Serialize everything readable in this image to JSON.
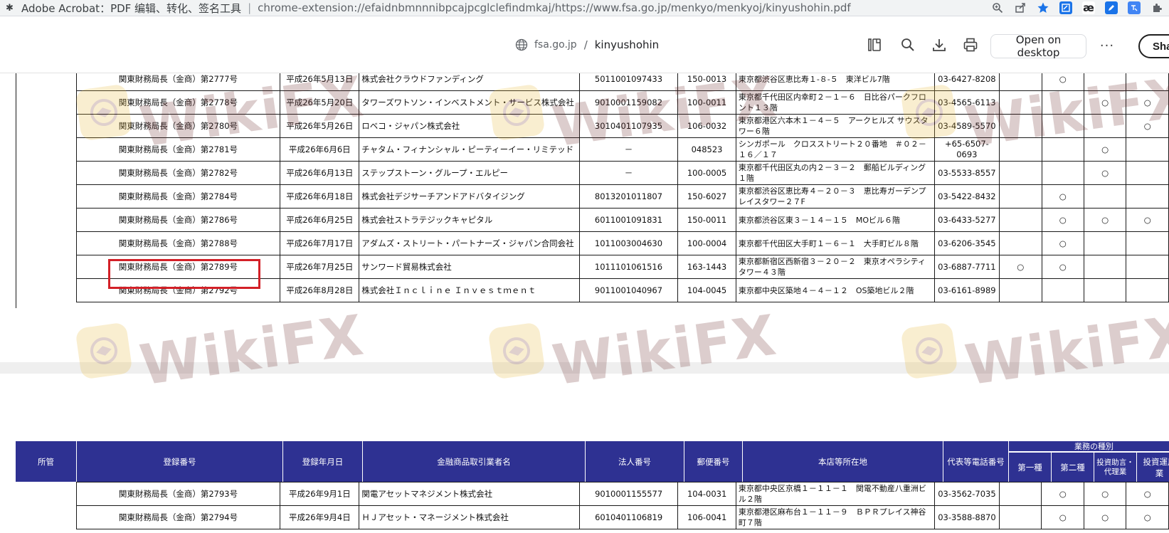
{
  "address_bar": {
    "app_name": "Adobe Acrobat：PDF 编辑、转化、签名工具",
    "separator": "|",
    "url": "chrome-extension://efaidnbmnnnibpcajpcglclefindmkaj/https://www.fsa.go.jp/menkyo/menkyoj/kinyushohin.pdf",
    "ext_ae_label": "æ"
  },
  "toolbar": {
    "domain": "fsa.go.jp",
    "slash": "/",
    "filename": "kinyushohin",
    "open_desktop": "Open on desktop",
    "more": "···",
    "share": "Share"
  },
  "watermark_text": "WikiFX",
  "header": {
    "jurisdiction": "所管",
    "reg_no": "登録番号",
    "reg_date": "登録年月日",
    "name": "金融商品取引業者名",
    "corp_no": "法人番号",
    "postal": "郵便番号",
    "address": "本店等所在地",
    "phone": "代表等電話番号",
    "business_type": "業務の種別",
    "type1": "第一種",
    "type2": "第二種",
    "advisory": "投資助言・代理業",
    "management": "投資運用業"
  },
  "rows_top": [
    {
      "reg_no": "関東財務局長（金商）第2777号",
      "date": "平成26年5月13日",
      "name": "株式会社クラウドファンディング",
      "corp": "5011001097433",
      "postal": "150-0013",
      "addr": "東京都渋谷区恵比寿１-８-５　東洋ビル7階",
      "tel": "03-6427-8208",
      "m1": "",
      "m2": "○",
      "m3": "",
      "m4": ""
    },
    {
      "reg_no": "関東財務局長（金商）第2778号",
      "date": "平成26年5月20日",
      "name": "タワーズワトソン・インベストメント・サービス株式会社",
      "corp": "9010001159082",
      "postal": "100-0011",
      "addr": "東京都千代田区内幸町２－１－６　日比谷パークフロント１３階",
      "tel": "03-4565-6113",
      "m1": "",
      "m2": "",
      "m3": "○",
      "m4": "○"
    },
    {
      "reg_no": "関東財務局長（金商）第2780号",
      "date": "平成26年5月26日",
      "name": "ロベコ・ジャパン株式会社",
      "corp": "3010401107935",
      "postal": "106-0032",
      "addr": "東京都港区六本木１－４－５　アークヒルズ サウスタワー６階",
      "tel": "03-4589-5570",
      "m1": "",
      "m2": "",
      "m3": "",
      "m4": "○"
    },
    {
      "reg_no": "関東財務局長（金商）第2781号",
      "date": "平成26年6月6日",
      "name": "チャタム・フィナンシャル・ピーティーイー・リミテッド",
      "corp": "－",
      "postal": "048523",
      "addr": "シンガポール　クロスストリート２０番地　＃０２－１６／１７",
      "tel": "+65-6507-0693",
      "m1": "",
      "m2": "",
      "m3": "○",
      "m4": ""
    },
    {
      "reg_no": "関東財務局長（金商）第2782号",
      "date": "平成26年6月13日",
      "name": "ステップストーン・グループ・エルピー",
      "corp": "－",
      "postal": "100-0005",
      "addr": "東京都千代田区丸の内２－３－２　郵船ビルディング１階",
      "tel": "03-5533-8557",
      "m1": "",
      "m2": "",
      "m3": "○",
      "m4": ""
    },
    {
      "reg_no": "関東財務局長（金商）第2784号",
      "date": "平成26年6月18日",
      "name": "株式会社デジサーチアンドアドバタイジング",
      "corp": "8013201011807",
      "postal": "150-6027",
      "addr": "東京都渋谷区恵比寿４－２０－３　恵比寿ガーデンプレイスタワー２７F",
      "tel": "03-5422-8432",
      "m1": "",
      "m2": "○",
      "m3": "",
      "m4": ""
    },
    {
      "reg_no": "関東財務局長（金商）第2786号",
      "date": "平成26年6月25日",
      "name": "株式会社ストラテジックキャピタル",
      "corp": "6011001091831",
      "postal": "150-0011",
      "addr": "東京都渋谷区東３－１４－１５　MOビル６階",
      "tel": "03-6433-5277",
      "m1": "",
      "m2": "○",
      "m3": "○",
      "m4": "○"
    },
    {
      "reg_no": "関東財務局長（金商）第2788号",
      "date": "平成26年7月17日",
      "name": "アダムズ・ストリート・パートナーズ・ジャパン合同会社",
      "corp": "1011003004630",
      "postal": "100-0004",
      "addr": "東京都千代田区大手町１－６－１　大手町ビル８階",
      "tel": "03-6206-3545",
      "m1": "",
      "m2": "○",
      "m3": "",
      "m4": ""
    },
    {
      "reg_no": "関東財務局長（金商）第2789号",
      "date": "平成26年7月25日",
      "name": "サンワード貿易株式会社",
      "corp": "1011101061516",
      "postal": "163-1443",
      "addr": "東京都新宿区西新宿３－２０－２　東京オペラシティタワー４３階",
      "tel": "03-6887-7711",
      "m1": "○",
      "m2": "○",
      "m3": "",
      "m4": ""
    },
    {
      "reg_no": "関東財務局長（金商）第2792号",
      "date": "平成26年8月28日",
      "name": "株式会社Ｉｎｃｌｉｎｅ Ｉｎｖｅｓｔｍｅｎｔ",
      "corp": "9011001040967",
      "postal": "104-0045",
      "addr": "東京都中央区築地４－４－１２　OS築地ビル２階",
      "tel": "03-6161-8989",
      "m1": "",
      "m2": "",
      "m3": "",
      "m4": ""
    }
  ],
  "rows_bottom": [
    {
      "reg_no": "関東財務局長（金商）第2793号",
      "date": "平成26年9月1日",
      "name": "関電アセットマネジメント株式会社",
      "corp": "9010001155577",
      "postal": "104-0031",
      "addr": "東京都中央区京橋１－１１－１　関電不動産八重洲ビル２階",
      "tel": "03-3562-7035",
      "m1": "",
      "m2": "○",
      "m3": "○",
      "m4": "○"
    },
    {
      "reg_no": "関東財務局長（金商）第2794号",
      "date": "平成26年9月4日",
      "name": "ＨＪアセット・マネージメント株式会社",
      "corp": "6010401106819",
      "postal": "106-0041",
      "addr": "東京都港区麻布台１－１１－９　ＢＰＲプレイス神谷町７階",
      "tel": "03-3588-8870",
      "m1": "",
      "m2": "○",
      "m3": "○",
      "m4": "○"
    }
  ]
}
